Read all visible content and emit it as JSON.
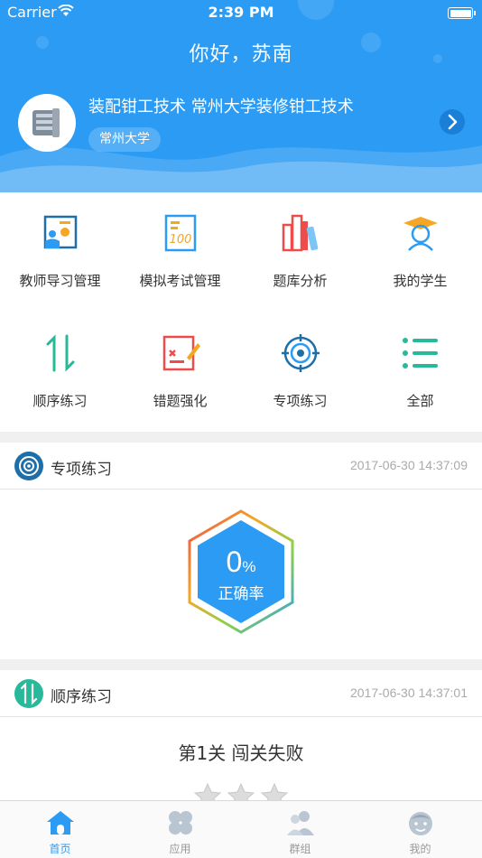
{
  "status_bar": {
    "carrier": "Carrier",
    "time": "2:39 PM"
  },
  "header": {
    "greeting": "你好，苏南",
    "course_title": "装配钳工技术  常州大学装修钳工技术",
    "school": "常州大学"
  },
  "grid": {
    "items": [
      {
        "label": "教师导习管理",
        "icon": "teacher-board-icon"
      },
      {
        "label": "模拟考试管理",
        "icon": "exam-paper-icon"
      },
      {
        "label": "题库分析",
        "icon": "books-icon"
      },
      {
        "label": "我的学生",
        "icon": "student-icon"
      },
      {
        "label": "顺序练习",
        "icon": "sequence-arrows-icon"
      },
      {
        "label": "错题强化",
        "icon": "wrong-answer-icon"
      },
      {
        "label": "专项练习",
        "icon": "target-icon"
      },
      {
        "label": "全部",
        "icon": "list-icon"
      }
    ]
  },
  "special_practice": {
    "title": "专项练习",
    "time": "2017-06-30 14:37:09",
    "accuracy_value": "0",
    "accuracy_unit": "%",
    "accuracy_label": "正确率"
  },
  "sequence_practice": {
    "title": "顺序练习",
    "time": "2017-06-30 14:37:01",
    "level_text": "第1关 闯关失败",
    "stars_earned": 0,
    "stars_total": 3
  },
  "tabbar": {
    "tabs": [
      {
        "label": "首页",
        "active": true
      },
      {
        "label": "应用",
        "active": false
      },
      {
        "label": "群组",
        "active": false
      },
      {
        "label": "我的",
        "active": false
      }
    ]
  },
  "colors": {
    "primary": "#2b9bf4",
    "teal": "#27b99a",
    "red": "#ee4b4b",
    "orange": "#f5a623",
    "dark_blue": "#1e6fa8"
  }
}
